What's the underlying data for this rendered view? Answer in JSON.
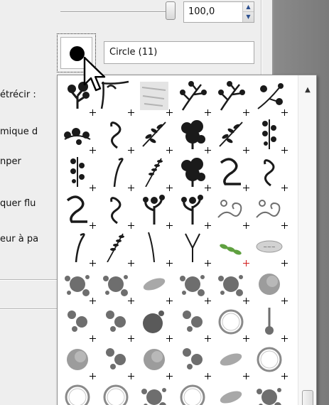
{
  "opacity": {
    "value": "100,0",
    "slider_fraction": 1.0
  },
  "brush": {
    "name": "Circle (11)",
    "preview_icon": "filled-circle-icon"
  },
  "options": {
    "labels": [
      "étrécir :",
      "mique d",
      "nper",
      "quer flu",
      "eur à pa"
    ]
  },
  "popup": {
    "kind": "brush-grid",
    "columns": 6,
    "rows": 9,
    "brushes": [
      [
        "tree-silhouette-icon",
        "corner-ornament-icon",
        "grunge-texture-icon",
        "branch-icon",
        "branch-icon",
        "floral-branch-icon"
      ],
      [
        "vine-cluster-icon",
        "swirl-icon",
        "leafy-branch-icon",
        "dense-foliage-icon",
        "leaf-sprig-icon",
        "vertical-vine-icon"
      ],
      [
        "berry-sprig-icon",
        "curved-stem-icon",
        "wheat-stem-icon",
        "palm-foliage-icon",
        "spiral-2-icon",
        "s-swirl-icon"
      ],
      [
        "spiral-2-icon",
        "s-swirl-icon",
        "tree-swirl-icon",
        "tree-swirl-icon",
        "scroll-flourish-icon",
        "scroll-flourish-icon"
      ],
      [
        "hook-stem-icon",
        "wheat-stalk-icon",
        "single-stem-icon",
        "forked-stem-icon",
        "green-leaves-icon",
        "ellipse-stamp-icon"
      ],
      [
        "ink-splatter-icon",
        "ink-splatter-icon",
        "ink-smudge-icon",
        "ink-splatter-icon",
        "ink-splatter-icon",
        "ink-blot-icon"
      ],
      [
        "droplets-icon",
        "droplets-icon",
        "ink-blob-icon",
        "droplets-icon",
        "coffee-ring-icon",
        "drip-icon"
      ],
      [
        "watercolor-blob-icon",
        "droplets-icon",
        "watercolor-blob-icon",
        "droplets-icon",
        "smudge-icon",
        "ring-stain-icon"
      ],
      [
        "coffee-ring-icon",
        "ring-stain-icon",
        "ink-splatter-icon",
        "ring-stain-icon",
        "smudge-icon",
        "splatter-icon"
      ]
    ],
    "colored_plus_cell": [
      4,
      4
    ],
    "scroll_up_icon": "triangle-up-icon"
  },
  "colors": {
    "accent_spin": "#2b4f8f",
    "green_brush": "#5fa040",
    "red_marker": "#d21a1a"
  }
}
